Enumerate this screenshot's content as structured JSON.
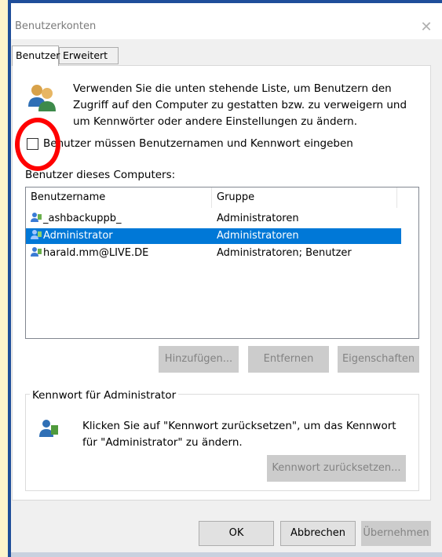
{
  "window": {
    "title": "Benutzerkonten",
    "close_glyph": "✕"
  },
  "tabs": [
    {
      "label": "Benutzer",
      "active": true
    },
    {
      "label": "Erweitert",
      "active": false
    }
  ],
  "intro_text": "Verwenden Sie die unten stehende Liste, um Benutzern den Zugriff auf den Computer zu gestatten bzw. zu verweigern und um Kennwörter oder andere Einstellungen zu ändern.",
  "require_login": {
    "label": "Benutzer müssen Benutzernamen und Kennwort eingeben",
    "checked": false
  },
  "users_list": {
    "label": "Benutzer dieses Computers:",
    "columns": [
      "Benutzername",
      "Gruppe"
    ],
    "rows": [
      {
        "name": "_ashbackuppb_",
        "group": "Administratoren",
        "selected": false
      },
      {
        "name": "Administrator",
        "group": "Administratoren",
        "selected": true
      },
      {
        "name": "harald.mm@LIVE.DE",
        "group": "Administratoren; Benutzer",
        "selected": false
      }
    ]
  },
  "list_buttons": {
    "add": "Hinzufügen...",
    "remove": "Entfernen",
    "properties": "Eigenschaften"
  },
  "password_section": {
    "title": "Kennwort für Administrator",
    "text": "Klicken Sie auf \"Kennwort zurücksetzen\", um das Kennwort für \"Administrator\" zu ändern.",
    "reset_button": "Kennwort zurücksetzen..."
  },
  "footer": {
    "ok": "OK",
    "cancel": "Abbrechen",
    "apply": "Übernehmen"
  },
  "colors": {
    "selection": "#0078d7",
    "highlight_circle": "#ff0000",
    "outer_background": "#fef4cc",
    "frame": "#1f4e9a"
  }
}
